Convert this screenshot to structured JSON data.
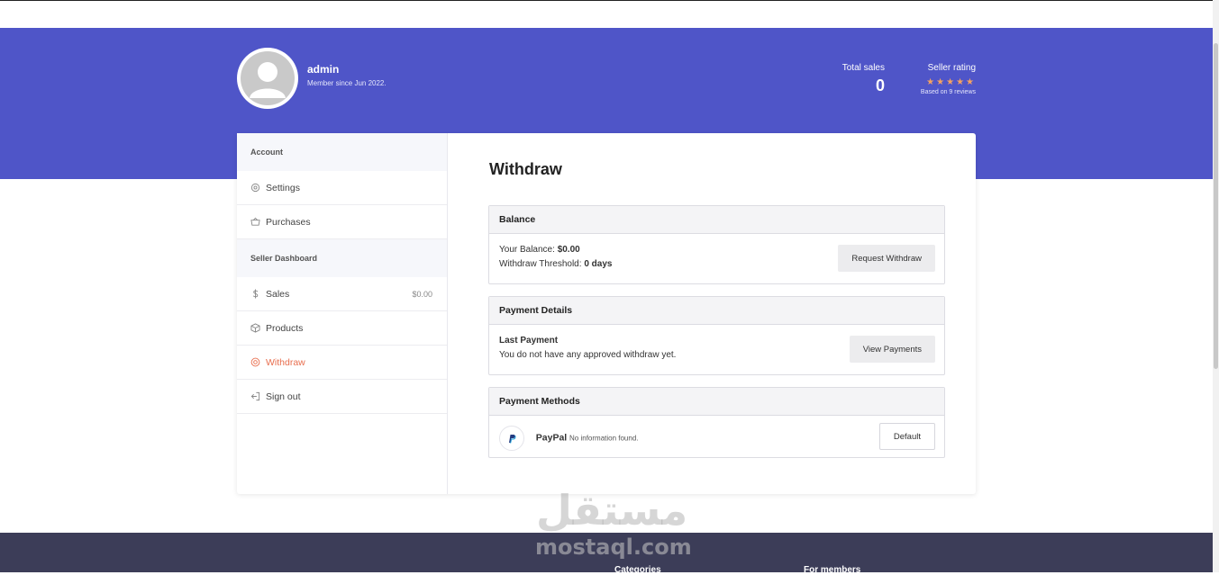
{
  "profile": {
    "username": "admin",
    "member_since": "Member since Jun 2022."
  },
  "stats": {
    "total_sales_label": "Total sales",
    "total_sales_value": "0",
    "seller_rating_label": "Seller rating",
    "stars": "★★★★★",
    "rating_fraction": 1.0,
    "reviews": "Based on 9 reviews",
    "star_color": "#f4a261"
  },
  "sidebar": {
    "account_heading": "Account",
    "settings": "Settings",
    "purchases": "Purchases",
    "seller_heading": "Seller Dashboard",
    "sales": "Sales",
    "sales_amount": "$0.00",
    "products": "Products",
    "withdraw": "Withdraw",
    "signout": "Sign out",
    "active_color": "#e86e4e"
  },
  "main": {
    "title": "Withdraw",
    "balance": {
      "heading": "Balance",
      "balance_label": "Your Balance:",
      "balance_value": "$0.00",
      "threshold_label": "Withdraw Threshold:",
      "threshold_value": "0 days",
      "button": "Request Withdraw"
    },
    "payment_details": {
      "heading": "Payment Details",
      "last_payment_label": "Last Payment",
      "last_payment_text": "You do not have any approved withdraw yet.",
      "button": "View Payments"
    },
    "payment_methods": {
      "heading": "Payment Methods",
      "method_name": "PayPal",
      "method_info": "No information found.",
      "button": "Default"
    }
  },
  "footer": {
    "categories": "Categories",
    "for_members": "For members"
  },
  "watermark": {
    "arabic": "مستقل",
    "latin": "mostaql.com"
  },
  "colors": {
    "hero": "#4f55c8",
    "footer": "#3c3d58"
  }
}
